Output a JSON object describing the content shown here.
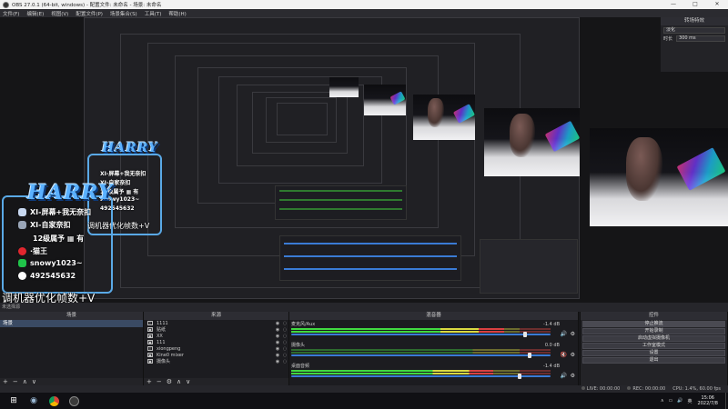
{
  "window": {
    "title": "OBS 27.0.1 (64-bit, windows) - 配置文件: 未命名 - 场景: 未命名",
    "min": "—",
    "max": "□",
    "close": "✕"
  },
  "menu": [
    "文件(F)",
    "编辑(E)",
    "视图(V)",
    "配置文件(P)",
    "场景集合(S)",
    "工具(T)",
    "帮助(H)"
  ],
  "overlay": {
    "logo_text": "HARRY",
    "lines": [
      "XI-屏幕+我无奈扣",
      "XI-自家奈扣",
      "12级属予 ▦ 有",
      "·猫王",
      "snowy1023~",
      "492545632"
    ],
    "caption": "调机器优化帧数+V"
  },
  "selection_label": "未选择源",
  "docks": {
    "scenes": {
      "title": "场景",
      "items": [
        "场景"
      ],
      "footer": [
        "+",
        "−",
        "∧",
        "∨"
      ]
    },
    "sources": {
      "title": "来源",
      "items": [
        {
          "icon": "T",
          "label": "1111"
        },
        {
          "icon": "▣",
          "label": "贴纸"
        },
        {
          "icon": "▣",
          "label": "XX"
        },
        {
          "icon": "▣",
          "label": "111"
        },
        {
          "icon": "T",
          "label": "xiongpeng"
        },
        {
          "icon": "▣",
          "label": "Kine0 mixer"
        },
        {
          "icon": "▣",
          "label": "摄像头"
        }
      ],
      "footer": [
        "+",
        "−",
        "⚙",
        "∧",
        "∨"
      ]
    },
    "mixer": {
      "title": "混音器",
      "channels": [
        {
          "name": "麦克风/Aux",
          "db": "-1.4 dB",
          "level": 0.82,
          "fader": 0.9,
          "muted": false
        },
        {
          "name": "摄像头",
          "db": "0.0 dB",
          "level": 0.0,
          "fader": 0.92,
          "muted": true
        },
        {
          "name": "桌面音频",
          "db": "-1.4 dB",
          "level": 0.78,
          "fader": 0.88,
          "muted": false
        }
      ]
    },
    "controls": {
      "title": "控件",
      "buttons": [
        "停止推流",
        "开始录制",
        "启动虚拟摄像机",
        "工作室模式",
        "设置",
        "退出"
      ]
    },
    "transitions": {
      "title": "转场特效",
      "transition": "淡化",
      "duration_label": "时长",
      "duration": "300 ms"
    }
  },
  "status": {
    "live": "LIVE: 00:00:00",
    "rec": "REC: 00:00:00",
    "cpu": "CPU: 1.4%, 60.00 fps"
  },
  "taskbar": {
    "time": "15:06",
    "date": "2022/7/8",
    "tray_lang": "英"
  },
  "colors": {
    "accent": "#5aa9e6",
    "selected_scene": "#3a4a63",
    "stop_stream": "#4a4a52"
  }
}
